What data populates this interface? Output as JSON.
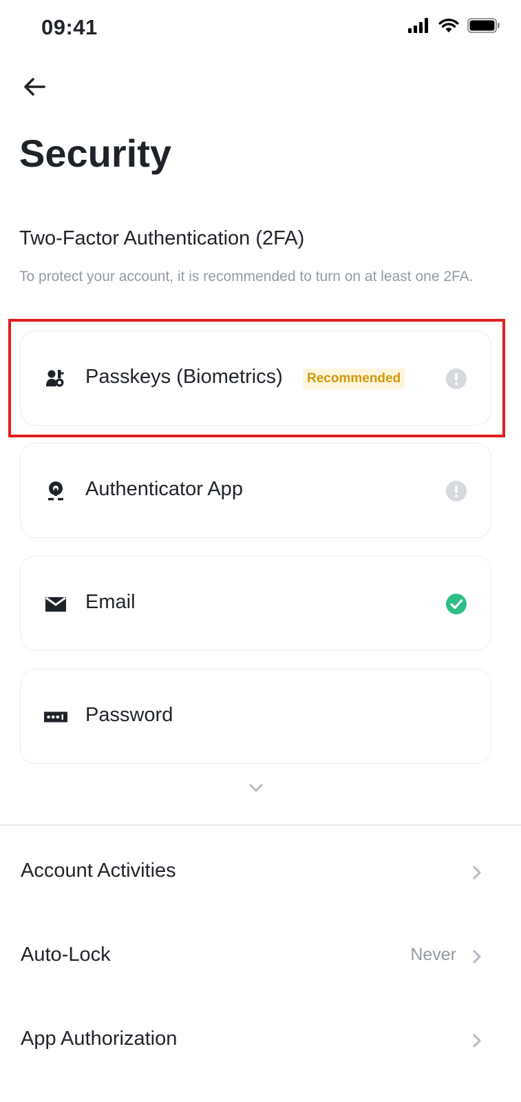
{
  "status_bar": {
    "time": "09:41"
  },
  "header": {
    "title": "Security"
  },
  "two_factor": {
    "heading": "Two-Factor Authentication (2FA)",
    "description": "To protect your account, it is recommended to turn on at least one 2FA.",
    "methods": [
      {
        "label": "Passkeys (Biometrics)",
        "badge": "Recommended",
        "icon": "passkey-icon",
        "status": "warning"
      },
      {
        "label": "Authenticator App",
        "icon": "authenticator-icon",
        "status": "warning"
      },
      {
        "label": "Email",
        "icon": "email-icon",
        "status": "enabled"
      },
      {
        "label": "Password",
        "icon": "password-icon",
        "status": "none"
      }
    ]
  },
  "settings": [
    {
      "label": "Account Activities",
      "value": ""
    },
    {
      "label": "Auto-Lock",
      "value": "Never"
    },
    {
      "label": "App Authorization",
      "value": ""
    }
  ],
  "colors": {
    "highlight": "#e01e1e",
    "badge_text": "#d0980b",
    "badge_bg": "#fdf6dc",
    "success": "#2ebd85",
    "warning_icon": "#d5d9de",
    "muted_text": "#929aa5"
  }
}
